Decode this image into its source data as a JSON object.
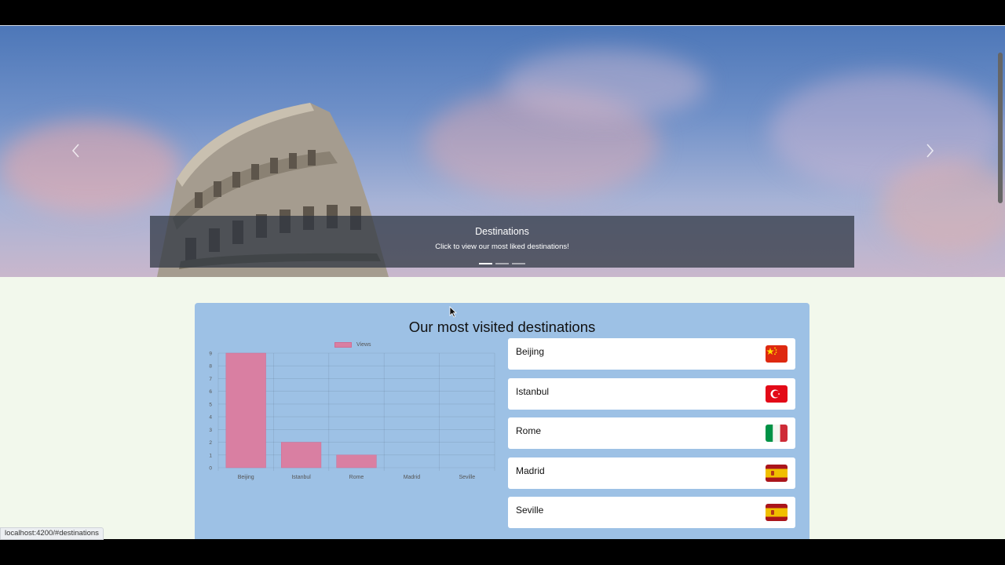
{
  "carousel": {
    "caption_title": "Destinations",
    "caption_text": "Click to view our most liked destinations!",
    "prev_icon": "chevron-left-icon",
    "next_icon": "chevron-right-icon",
    "slide_count": 3,
    "active_slide": 1
  },
  "section": {
    "title": "Our most visited destinations"
  },
  "chart_data": {
    "type": "bar",
    "categories": [
      "Beijing",
      "Istanbul",
      "Rome",
      "Madrid",
      "Seville"
    ],
    "series": [
      {
        "name": "Views",
        "values": [
          9,
          2,
          1,
          0,
          0
        ],
        "color": "#d97fa2"
      }
    ],
    "ylim": [
      0,
      9
    ],
    "yticks": [
      0,
      1,
      2,
      3,
      4,
      5,
      6,
      7,
      8,
      9
    ],
    "grid": true,
    "legend": "top-center"
  },
  "destinations": [
    {
      "name": "Beijing",
      "flag": "china-flag-icon"
    },
    {
      "name": "Istanbul",
      "flag": "turkey-flag-icon"
    },
    {
      "name": "Rome",
      "flag": "italy-flag-icon"
    },
    {
      "name": "Madrid",
      "flag": "spain-flag-icon"
    },
    {
      "name": "Seville",
      "flag": "spain-flag-icon"
    }
  ],
  "status": {
    "url": "localhost:4200/#destinations"
  },
  "colors": {
    "page_bg": "#f2f8ec",
    "card_bg": "#9dc1e5",
    "bar": "#d97fa2"
  }
}
